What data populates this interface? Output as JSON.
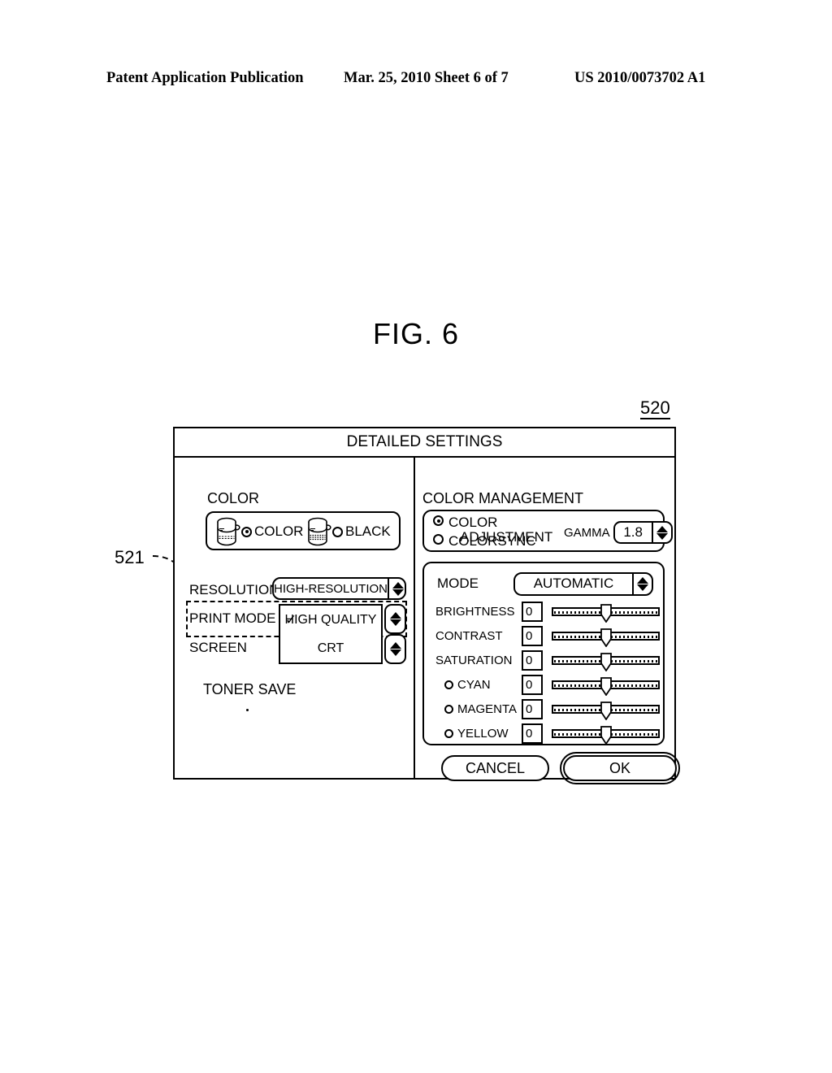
{
  "patent_header": {
    "publication": "Patent Application Publication",
    "date_sheet": "Mar. 25, 2010  Sheet 6 of 7",
    "number": "US 2010/0073702 A1"
  },
  "figure": {
    "label": "FIG. 6",
    "dialog_callout": "520",
    "printmode_callout": "521"
  },
  "dialog": {
    "title": "DETAILED SETTINGS",
    "color_section": {
      "label": "COLOR",
      "options": [
        {
          "label": "COLOR",
          "icon": "toner-cartridge-icon",
          "selected": true
        },
        {
          "label": "BLACK",
          "icon": "toner-cartridge-icon",
          "selected": false
        }
      ]
    },
    "settings_rows": {
      "resolution": {
        "label": "RESOLUTION",
        "value": "HIGH-RESOLUTION"
      },
      "print_mode": {
        "label": "PRINT MODE",
        "value": "HIGH QUALITY",
        "check": "✓"
      },
      "screen": {
        "label": "SCREEN",
        "value": "CRT"
      }
    },
    "toner_save": {
      "label": "TONER SAVE"
    },
    "color_management": {
      "label": "COLOR MANAGEMENT",
      "options": [
        {
          "line1": "COLOR",
          "line2": "ADJUSTMENT",
          "selected": true
        },
        {
          "line1": "COLORSYNC",
          "line2": "",
          "selected": false
        }
      ],
      "gamma": {
        "label": "GAMMA",
        "value": "1.8"
      }
    },
    "controls": {
      "mode": {
        "label": "MODE",
        "value": "AUTOMATIC"
      },
      "sliders": [
        {
          "label": "BRIGHTNESS",
          "value": "0",
          "radio": false,
          "position_pct": 50
        },
        {
          "label": "CONTRAST",
          "value": "0",
          "radio": false,
          "position_pct": 50
        },
        {
          "label": "SATURATION",
          "value": "0",
          "radio": false,
          "position_pct": 50
        },
        {
          "label": "CYAN",
          "value": "0",
          "radio": true,
          "position_pct": 50
        },
        {
          "label": "MAGENTA",
          "value": "0",
          "radio": true,
          "position_pct": 50
        },
        {
          "label": "YELLOW",
          "value": "0",
          "radio": true,
          "position_pct": 50
        }
      ]
    },
    "buttons": {
      "cancel": "CANCEL",
      "ok": "OK"
    }
  }
}
